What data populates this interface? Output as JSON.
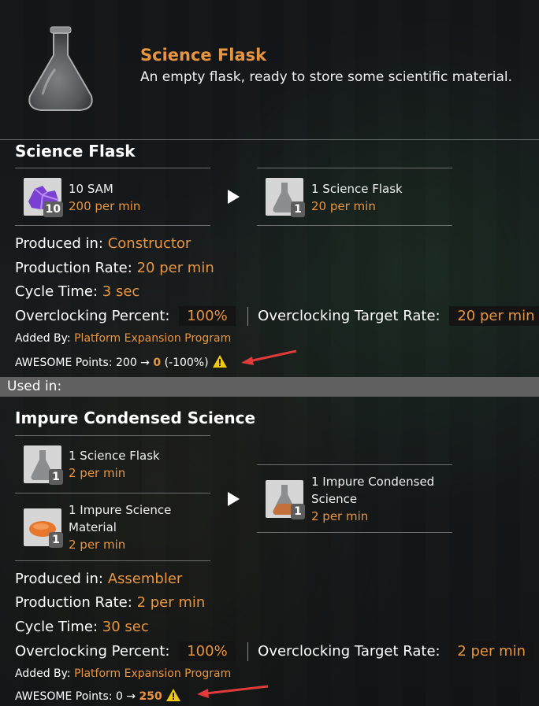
{
  "header": {
    "item_name": "Science Flask",
    "description": "An empty flask, ready to store some scientific material.",
    "icon": "flask-icon"
  },
  "recipe1": {
    "title": "Science Flask",
    "inputs": [
      {
        "name": "10 SAM",
        "rate": "200 per min",
        "count": "10",
        "icon": "sam-ore-icon"
      }
    ],
    "outputs": [
      {
        "name": "1 Science Flask",
        "rate": "20 per min",
        "count": "1",
        "icon": "flask-icon"
      }
    ],
    "produced_in_label": "Produced in:",
    "produced_in": "Constructor",
    "production_rate_label": "Production Rate:",
    "production_rate": "20 per min",
    "cycle_time_label": "Cycle Time:",
    "cycle_time": "3 sec",
    "oc_percent_label": "Overclocking Percent:",
    "oc_percent": "100%",
    "oc_target_label": "Overclocking Target Rate:",
    "oc_target": "20 per min",
    "added_by_label": "Added By:",
    "added_by": "Platform Expansion Program",
    "points_label": "AWESOME Points: 200 →",
    "points_value": "0",
    "points_extra": "(-100%)",
    "warning_icon": "warning-icon"
  },
  "used_in_label": "Used in:",
  "recipe2": {
    "title": "Impure Condensed Science",
    "inputs": [
      {
        "name": "1 Science Flask",
        "rate": "2 per min",
        "count": "1",
        "icon": "flask-icon"
      },
      {
        "name": "1 Impure Science Material",
        "rate": "2 per min",
        "count": "1",
        "icon": "impure-material-icon"
      }
    ],
    "outputs": [
      {
        "name": "1 Impure Condensed Science",
        "rate": "2 per min",
        "count": "1",
        "icon": "filled-flask-icon"
      }
    ],
    "produced_in_label": "Produced in:",
    "produced_in": "Assembler",
    "production_rate_label": "Production Rate:",
    "production_rate": "2 per min",
    "cycle_time_label": "Cycle Time:",
    "cycle_time": "30 sec",
    "oc_percent_label": "Overclocking Percent:",
    "oc_percent": "100%",
    "oc_target_label": "Overclocking Target Rate:",
    "oc_target": "2 per min",
    "added_by_label": "Added By:",
    "added_by": "Platform Expansion Program",
    "points_label": "AWESOME Points: 0 →",
    "points_value": "250",
    "warning_icon": "warning-icon"
  },
  "annotation_color": "#e03a3a",
  "accent_color": "#e8953f"
}
